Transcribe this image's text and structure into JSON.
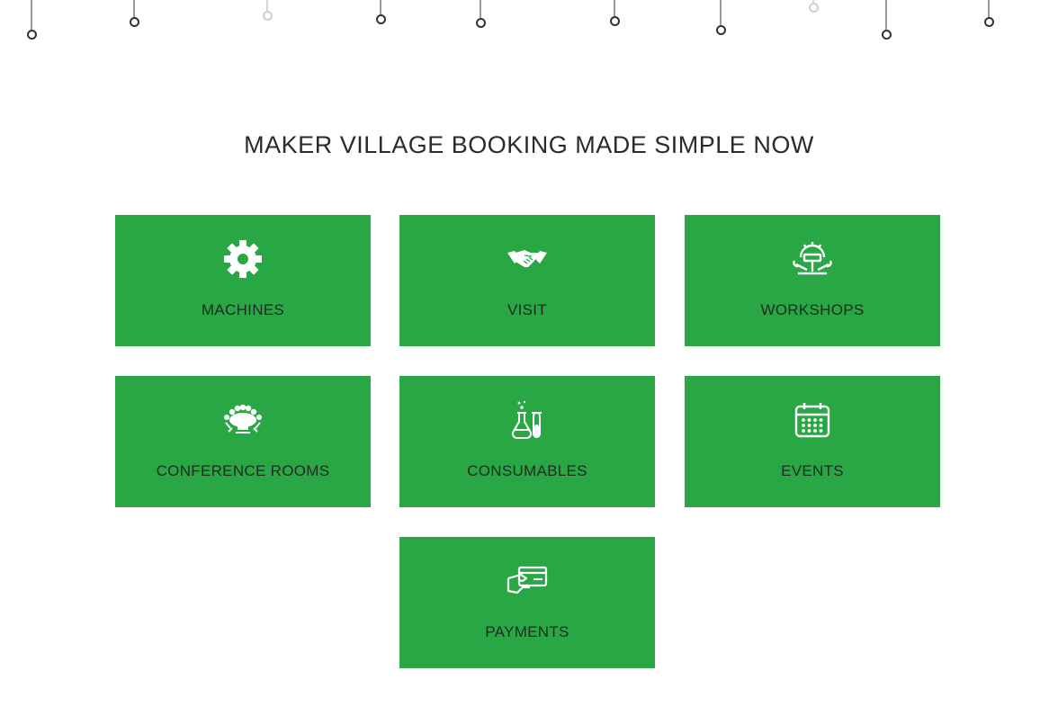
{
  "page_title": "MAKER VILLAGE BOOKING MADE SIMPLE NOW",
  "colors": {
    "tile_bg": "#29a744",
    "tile_text": "#1f2a22",
    "title_text": "#2b2b2b"
  },
  "tiles": [
    {
      "label": "MACHINES",
      "icon": "gear-icon"
    },
    {
      "label": "VISIT",
      "icon": "handshake-icon"
    },
    {
      "label": "WORKSHOPS",
      "icon": "workshop-tools-icon"
    },
    {
      "label": "CONFERENCE ROOMS",
      "icon": "conference-table-icon"
    },
    {
      "label": "CONSUMABLES",
      "icon": "lab-flask-icon"
    },
    {
      "label": "EVENTS",
      "icon": "calendar-icon"
    },
    {
      "label": "PAYMENTS",
      "icon": "card-payment-icon"
    }
  ]
}
